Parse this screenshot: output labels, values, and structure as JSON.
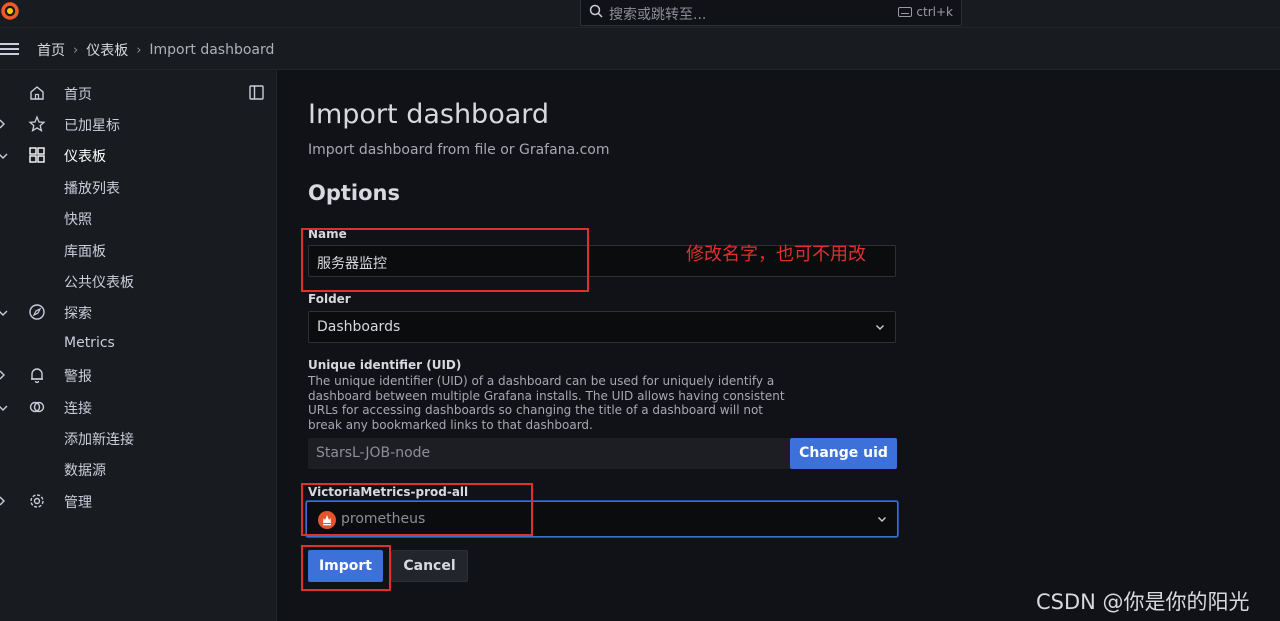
{
  "search": {
    "placeholder": "搜索或跳转至...",
    "shortcut": "ctrl+k"
  },
  "breadcrumb": {
    "home": "首页",
    "dashboards": "仪表板",
    "current": "Import dashboard"
  },
  "sidebar": {
    "items": [
      {
        "label": "首页",
        "icon": "home-icon"
      },
      {
        "label": "已加星标",
        "icon": "star-icon"
      },
      {
        "label": "仪表板",
        "icon": "apps-icon"
      },
      {
        "label": "播放列表"
      },
      {
        "label": "快照"
      },
      {
        "label": "库面板"
      },
      {
        "label": "公共仪表板"
      },
      {
        "label": "探索",
        "icon": "compass-icon"
      },
      {
        "label": "Metrics"
      },
      {
        "label": "警报",
        "icon": "bell-icon"
      },
      {
        "label": "连接",
        "icon": "link-icon"
      },
      {
        "label": "添加新连接"
      },
      {
        "label": "数据源"
      },
      {
        "label": "管理",
        "icon": "gear-icon"
      }
    ]
  },
  "page": {
    "title": "Import dashboard",
    "subtitle": "Import dashboard from file or Grafana.com",
    "options_heading": "Options"
  },
  "form": {
    "name_label": "Name",
    "name_value": "服务器监控",
    "folder_label": "Folder",
    "folder_value": "Dashboards",
    "uid_label": "Unique identifier (UID)",
    "uid_help": "The unique identifier (UID) of a dashboard can be used for uniquely identify a dashboard between multiple Grafana installs. The UID allows having consistent URLs for accessing dashboards so changing the title of a dashboard will not break any bookmarked links to that dashboard.",
    "uid_value": "StarsL-JOB-node",
    "change_uid_label": "Change uid",
    "datasource_label": "VictoriaMetrics-prod-all",
    "datasource_value": "prometheus",
    "import_label": "Import",
    "cancel_label": "Cancel"
  },
  "annotation": "修改名字，也可不用改",
  "watermark": "CSDN @你是你的阳光",
  "colors": {
    "accent": "#3d71d9",
    "annotation": "#e02f2f",
    "background": "#111217",
    "panel": "#181b1f"
  }
}
